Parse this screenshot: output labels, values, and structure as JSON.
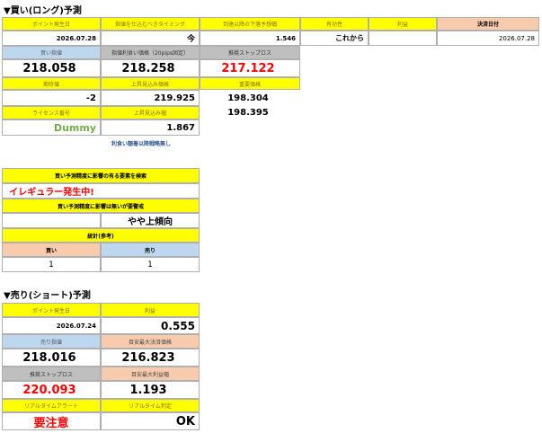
{
  "long": {
    "title": "▼買い(ロング)予測",
    "headers": {
      "point_date": "ポイント発生日",
      "entry_timing": "指値を仕込むべきタイミング",
      "expected_low": "到達以降の下落予想幅",
      "valid": "有効性",
      "profit": "利益",
      "settle_date": "決済日付"
    },
    "row1": {
      "point_date": "2026.07.28",
      "entry_timing": "今",
      "expected_low": "1.546",
      "valid": "これから",
      "profit": "",
      "settle_date": "2026.07.28"
    },
    "row2_headers": {
      "buy_entry": "買い指値",
      "spread_entry": "指値利食い価格（20pips固定）",
      "stop": "推奨ストップロス"
    },
    "row2": {
      "buy_entry": "218.058",
      "spread_entry": "218.258",
      "stop": "217.122"
    },
    "row3_headers": {
      "expected": "期待値",
      "upper": "上昇見込み価格",
      "important": "重要価格"
    },
    "row3": {
      "expected": "-2",
      "upper": "219.925",
      "important1": "198.304",
      "important2": "198.395"
    },
    "row4_headers": {
      "license": "ライセンス番号",
      "upper_width": "上昇見込み幅"
    },
    "row4": {
      "license": "Dummy",
      "upper_width": "1.867"
    },
    "note": "利食い額着以降戦略無し"
  },
  "irregular": {
    "header1": "買い予測精度に影響の有る要素を検索",
    "alert": "イレギュラー発生中!",
    "header2": "買い予測精度に影響は無いが要警戒",
    "trend": "やや上傾向",
    "header3": "統計(参考)",
    "buy_label": "買い",
    "sell_label": "売り",
    "buy_count": "1",
    "sell_count": "1"
  },
  "short": {
    "title": "▼売り(ショート)予測",
    "headers": {
      "point_date": "ポイント発生日",
      "profit": "利益"
    },
    "row1": {
      "point_date": "2026.07.24",
      "profit": "0.555"
    },
    "row2_headers": {
      "sell_entry": "売り指値",
      "max_price": "目安最大決済価格"
    },
    "row2": {
      "sell_entry": "218.016",
      "max_price": "216.823"
    },
    "row3_headers": {
      "stop": "推奨ストップロス",
      "max_profit": "目安最大利益幅"
    },
    "row3": {
      "stop": "220.093",
      "max_profit": "1.193"
    },
    "row4_headers": {
      "alert": "リアルタイムアラート",
      "judge": "リアルタイム判定"
    },
    "row4": {
      "alert": "要注意",
      "judge": "OK"
    }
  },
  "colors": {
    "header_yellow": "#ffff00",
    "header_text": "#8a6d00",
    "alert_red": "#ff0000",
    "dummy_green": "#70ad47",
    "blue": "#bdd7ee",
    "peach": "#f8cbad",
    "gray": "#bfbfbf"
  }
}
